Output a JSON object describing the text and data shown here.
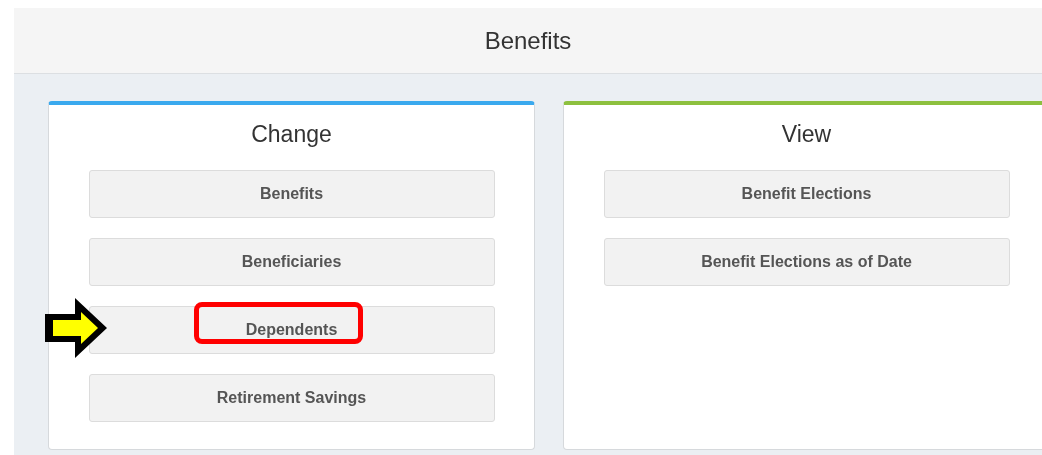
{
  "header": {
    "title": "Benefits"
  },
  "cards": [
    {
      "title": "Change",
      "color": "#3aa9ee",
      "buttons": [
        {
          "label": "Benefits",
          "highlighted": false
        },
        {
          "label": "Beneficiaries",
          "highlighted": false
        },
        {
          "label": "Dependents",
          "highlighted": true
        },
        {
          "label": "Retirement Savings",
          "highlighted": false
        }
      ]
    },
    {
      "title": "View",
      "color": "#8dc03f",
      "buttons": [
        {
          "label": "Benefit Elections",
          "highlighted": false
        },
        {
          "label": "Benefit Elections as of Date",
          "highlighted": false
        }
      ]
    }
  ]
}
